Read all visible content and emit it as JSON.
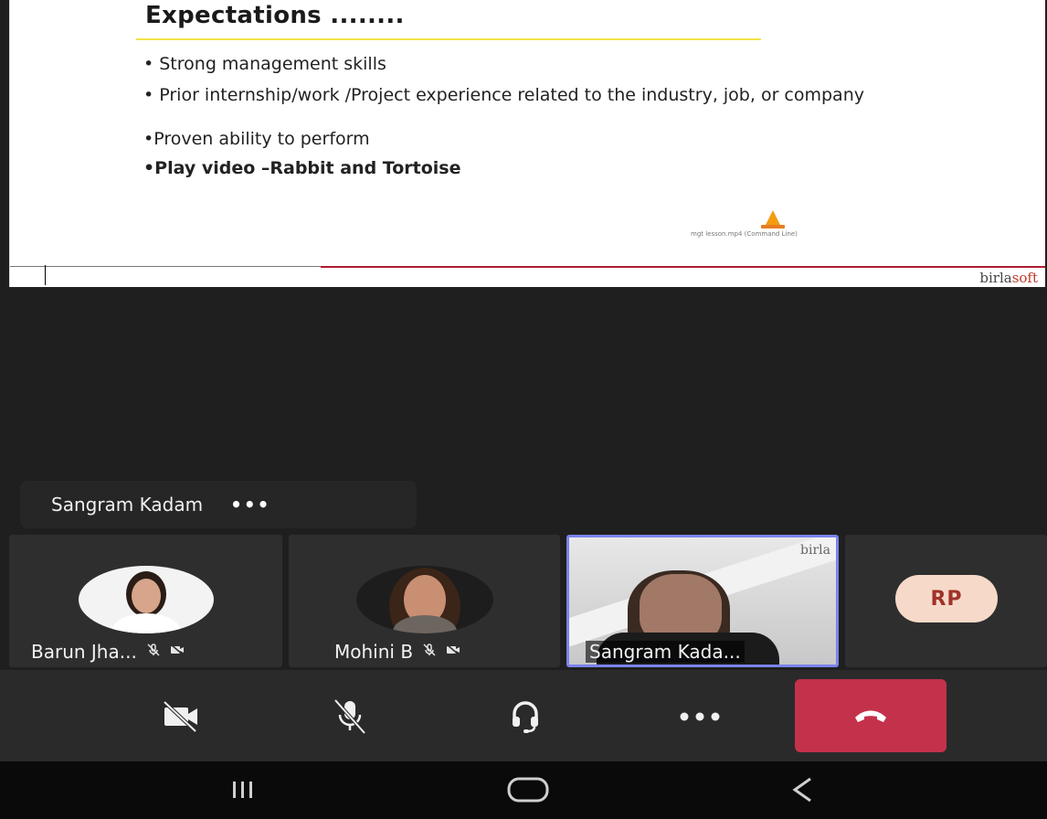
{
  "slide": {
    "title": "Expectations ........",
    "bullets": [
      "• Strong management skills",
      "• Prior internship/work /Project experience related to the industry, job, or company",
      "•Proven ability to perform",
      "•Play video –Rabbit and Tortoise"
    ],
    "media_label": "mgt lesson.mp4 (Command Line)",
    "brand_part1": "birla",
    "brand_part2": "soft"
  },
  "speaker": {
    "name": "Sangram Kadam",
    "more_label": "•••"
  },
  "participants": [
    {
      "name": "Barun Jha...",
      "avatar": "photo"
    },
    {
      "name": "Mohini B",
      "avatar": "photo"
    },
    {
      "name": "Sangram Kada...",
      "avatar": "video",
      "video_brand": "birla"
    },
    {
      "name": "",
      "initials": "RP"
    }
  ],
  "controls": {
    "camera": {
      "icon": "camera-off-icon"
    },
    "mic": {
      "icon": "mic-off-icon"
    },
    "audio": {
      "icon": "headset-icon"
    },
    "more": {
      "icon": "more-horizontal-icon",
      "label": "•••"
    },
    "leave": {
      "icon": "hang-up-icon",
      "color": "#c4314b"
    }
  },
  "android_nav": {
    "recents": "recents-icon",
    "home": "home-icon",
    "back": "back-icon"
  },
  "colors": {
    "active_speaker_border": "#7b83eb",
    "leave": "#c4314b",
    "background": "#1f1f1f"
  }
}
